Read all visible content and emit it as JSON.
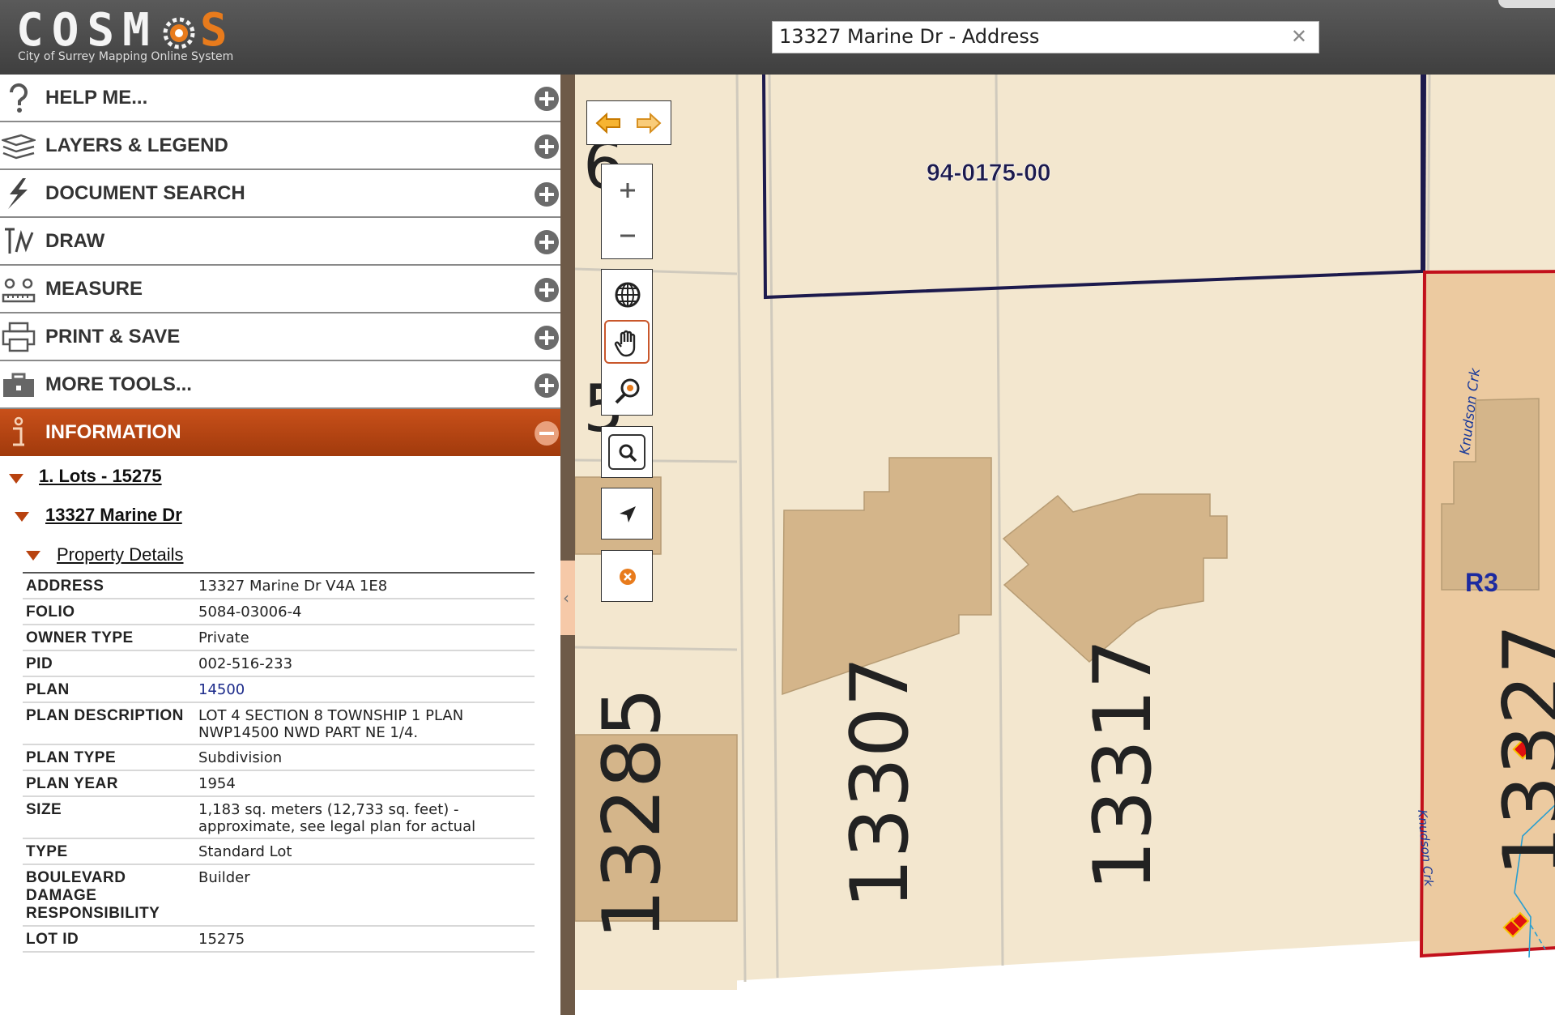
{
  "header": {
    "logo_text_left": "COSM",
    "logo_text_right": "S",
    "logo_subtitle": "City of Surrey Mapping Online System",
    "search_value": "13327 Marine Dr - Address"
  },
  "sidebar": {
    "menu": [
      {
        "label": "HELP ME...",
        "icon": "help-icon"
      },
      {
        "label": "LAYERS & LEGEND",
        "icon": "layers-icon"
      },
      {
        "label": "DOCUMENT SEARCH",
        "icon": "lightning-icon"
      },
      {
        "label": "DRAW",
        "icon": "draw-icon"
      },
      {
        "label": "MEASURE",
        "icon": "measure-icon"
      },
      {
        "label": "PRINT & SAVE",
        "icon": "printer-icon"
      },
      {
        "label": "MORE TOOLS...",
        "icon": "toolbox-icon"
      },
      {
        "label": "INFORMATION",
        "icon": "info-icon"
      }
    ],
    "tree": {
      "lots": "1. Lots - 15275",
      "address": "13327 Marine Dr",
      "details": "Property Details"
    },
    "properties": [
      {
        "key": "ADDRESS",
        "value": "13327 Marine Dr V4A 1E8"
      },
      {
        "key": "FOLIO",
        "value": "5084-03006-4"
      },
      {
        "key": "OWNER TYPE",
        "value": "Private"
      },
      {
        "key": "PID",
        "value": "002-516-233"
      },
      {
        "key": "PLAN",
        "value": "14500"
      },
      {
        "key": "PLAN DESCRIPTION",
        "value": "LOT 4 SECTION 8 TOWNSHIP 1 PLAN NWP14500 NWD PART NE 1/4."
      },
      {
        "key": "PLAN TYPE",
        "value": "Subdivision"
      },
      {
        "key": "PLAN YEAR",
        "value": "1954"
      },
      {
        "key": "SIZE",
        "value": "1,183 sq. meters (12,733 sq. feet) - approximate, see legal plan for actual"
      },
      {
        "key": "TYPE",
        "value": "Standard Lot"
      },
      {
        "key": "BOULEVARD DAMAGE RESPONSIBILITY",
        "value": "Builder"
      },
      {
        "key": "LOT ID",
        "value": "15275"
      }
    ]
  },
  "map": {
    "lot_labels": [
      "13285",
      "13307",
      "13317",
      "13327"
    ],
    "parcel_id": "94-0175-00",
    "zone": "R3",
    "creek_name": "Knudson Crk",
    "colors": {
      "lot_fill": "#f3e7cf",
      "building": "#d4b58a",
      "selected_fill": "#eccaa0",
      "selected_border": "#c2101b",
      "parcel_line": "#1c1a4d",
      "creek": "#2a9fd0"
    }
  },
  "tools": [
    "back-arrow-icon",
    "forward-arrow-icon",
    "zoom-in-icon",
    "zoom-out-icon",
    "globe-icon",
    "pan-hand-icon",
    "zoom-area-icon",
    "search-icon",
    "locate-arrow-icon",
    "clear-icon"
  ]
}
